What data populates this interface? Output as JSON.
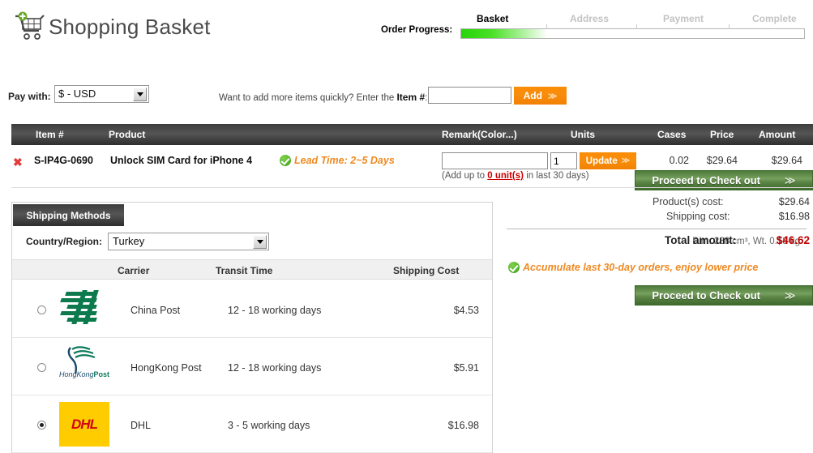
{
  "header": {
    "title": "Shopping Basket",
    "cart_icon": "shopping-cart-icon"
  },
  "progress": {
    "label": "Order Progress:",
    "steps": [
      {
        "label": "Basket",
        "active": true
      },
      {
        "label": "Address",
        "active": false
      },
      {
        "label": "Payment",
        "active": false
      },
      {
        "label": "Complete",
        "active": false
      }
    ],
    "fill_percent": 25,
    "fill_color": "#27d40c"
  },
  "toolbar": {
    "pay_with_label": "Pay with:",
    "currency_value": "$ - USD",
    "quick_add_text": "Want to add more items quickly? Enter the ",
    "quick_add_bold": "Item #",
    "quick_add_colon": ":",
    "item_input_value": "",
    "item_input_placeholder": "",
    "add_label": "Add",
    "chevron": "≫",
    "checkout_label": "Proceed to Check out"
  },
  "table": {
    "columns": [
      "Item #",
      "Product",
      "Remark(Color...)",
      "Units",
      "Cases",
      "Price",
      "Amount"
    ]
  },
  "product": {
    "delete_icon": "delete-x-icon",
    "sku": "S-IP4G-0690",
    "name": "Unlock SIM Card for iPhone 4",
    "lead_time": "Lead Time: 2~5 Days",
    "remark_value": "",
    "units_value": "1",
    "update_label": "Update",
    "addup_prefix": "(Add up to ",
    "addup_link": "0 unit(s)",
    "addup_suffix": " in last 30 days)",
    "cases": "0.02",
    "price": "$29.64",
    "amount": "$29.64"
  },
  "shipping": {
    "tab_label": "Shipping Methods",
    "country_label": "Country/Region:",
    "country_value": "Turkey",
    "dims": "Dim. 288 cm³, Wt. 0.18 kg",
    "columns": [
      "Carrier",
      "Transit Time",
      "Shipping Cost"
    ],
    "methods": [
      {
        "carrier": "China Post",
        "transit": "12 - 18 working days",
        "cost": "$4.53",
        "selected": false,
        "logo": "china-post-logo"
      },
      {
        "carrier": "HongKong Post",
        "transit": "12 - 18 working days",
        "cost": "$5.91",
        "selected": false,
        "logo": "hongkong-post-logo"
      },
      {
        "carrier": "DHL",
        "transit": "3 - 5 working days",
        "cost": "$16.98",
        "selected": true,
        "logo": "dhl-logo"
      }
    ],
    "hk_logo_text_1": "HongKong",
    "hk_logo_text_2": "Post",
    "dhl_logo_text": "DHL"
  },
  "summary": {
    "product_cost_label": "Product(s) cost:",
    "product_cost_value": "$29.64",
    "shipping_cost_label": "Shipping cost:",
    "shipping_cost_value": "$16.98",
    "total_label": "Total amount:",
    "total_value": "$46.62",
    "total_color": "#c00000",
    "accumulate_note": "Accumulate last 30-day orders, enjoy lower price",
    "checkout_label": "Proceed to Check out"
  }
}
